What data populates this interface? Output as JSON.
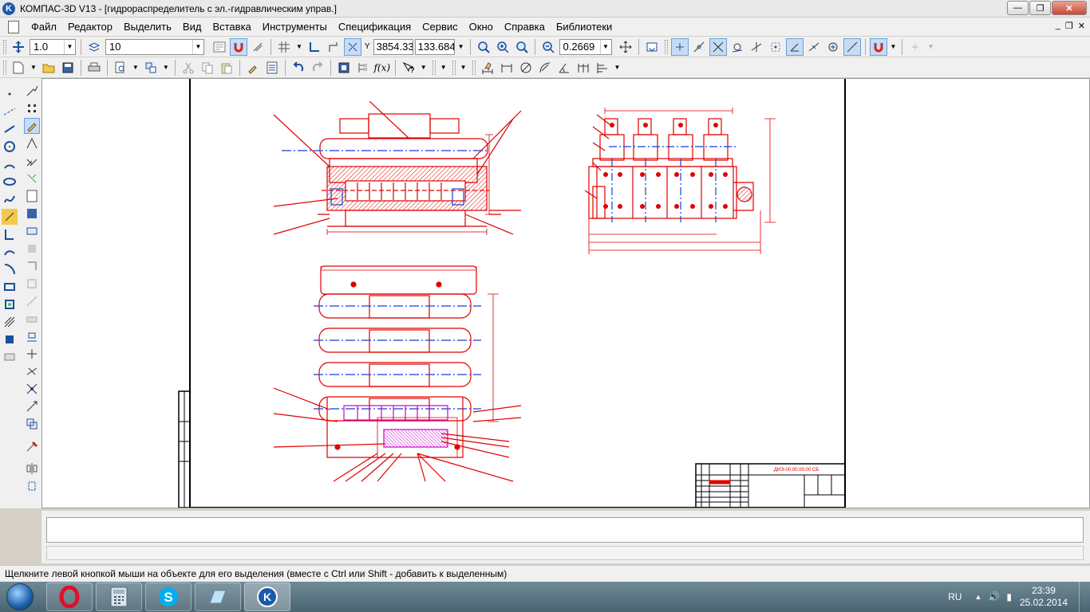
{
  "window": {
    "title": "КОМПАС-3D V13 - [гидрораспределитель с эл.-гидравлическим управ.]",
    "app_icon_letter": "K",
    "minimize": "—",
    "maximize": "❐",
    "close": "✕"
  },
  "menu": {
    "items": [
      "Файл",
      "Редактор",
      "Выделить",
      "Вид",
      "Вставка",
      "Инструменты",
      "Спецификация",
      "Сервис",
      "Окно",
      "Справка",
      "Библиотеки"
    ],
    "mdi_minimize": "_",
    "mdi_restore": "❐",
    "mdi_close": "✕"
  },
  "toolbar1": {
    "step_value": "1.0",
    "layer_value": "10",
    "x_label": "Y",
    "coord_x": "3854.33",
    "coord_y": "133.684",
    "zoom_value": "0.2669"
  },
  "drawing": {
    "title_block_text": "ДИЭ-00.00.00.00 СБ"
  },
  "status": {
    "hint": "Щелкните левой кнопкой мыши на объекте для его выделения (вместе с Ctrl или Shift - добавить к выделенным)"
  },
  "taskbar": {
    "language": "RU",
    "time": "23:39",
    "date": "25.02.2014"
  },
  "colors": {
    "drawing_lines": "#e00000",
    "hatch": "#d000d0",
    "frame": "#000000",
    "title_close": "#c94a38"
  }
}
